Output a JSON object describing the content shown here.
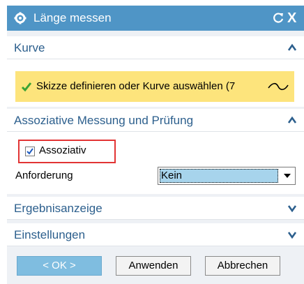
{
  "dialog": {
    "title": "Länge messen",
    "close_symbol": "X",
    "sections": {
      "kurve": {
        "label": "Kurve",
        "state": "expanded"
      },
      "assoc": {
        "label": "Assoziative Messung und Prüfung",
        "state": "expanded"
      },
      "ergebnis": {
        "label": "Ergebnisanzeige",
        "state": "collapsed"
      },
      "einstellungen": {
        "label": "Einstellungen",
        "state": "collapsed"
      }
    },
    "curve_select_text": "Skizze definieren oder Kurve auswählen (7",
    "associative_checkbox": {
      "label": "Assoziativ",
      "checked": true
    },
    "requirement": {
      "label": "Anforderung",
      "value": "Kein"
    },
    "buttons": {
      "ok": "< OK >",
      "apply": "Anwenden",
      "cancel": "Abbrechen"
    }
  },
  "colors": {
    "titlebar": "#4f95c6",
    "section_label": "#2c5f8d",
    "selection_highlight": "#fde47c",
    "dropdown_selected": "#a7d4ec",
    "callout_border": "#e23434"
  },
  "icons": {
    "title_gear": "gear-icon",
    "reset": "reset-icon",
    "curve": "curve-icon",
    "check": "green-check-icon"
  }
}
